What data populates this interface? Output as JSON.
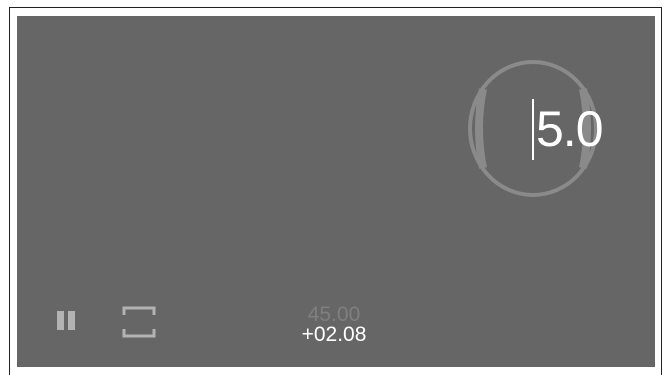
{
  "player": {
    "background_color": "#666666",
    "dial": {
      "value": "5.0",
      "ring_color": "#8a8a8a",
      "value_color": "#ffffff"
    },
    "controls": {
      "pause_icon": "pause-icon",
      "fullscreen_icon": "fullscreen-icon",
      "icon_color": "#b3b3b3"
    },
    "readout": {
      "main": "45.00",
      "offset": "+02.08",
      "main_color": "#7f7f7f",
      "offset_color": "#ffffff"
    }
  }
}
